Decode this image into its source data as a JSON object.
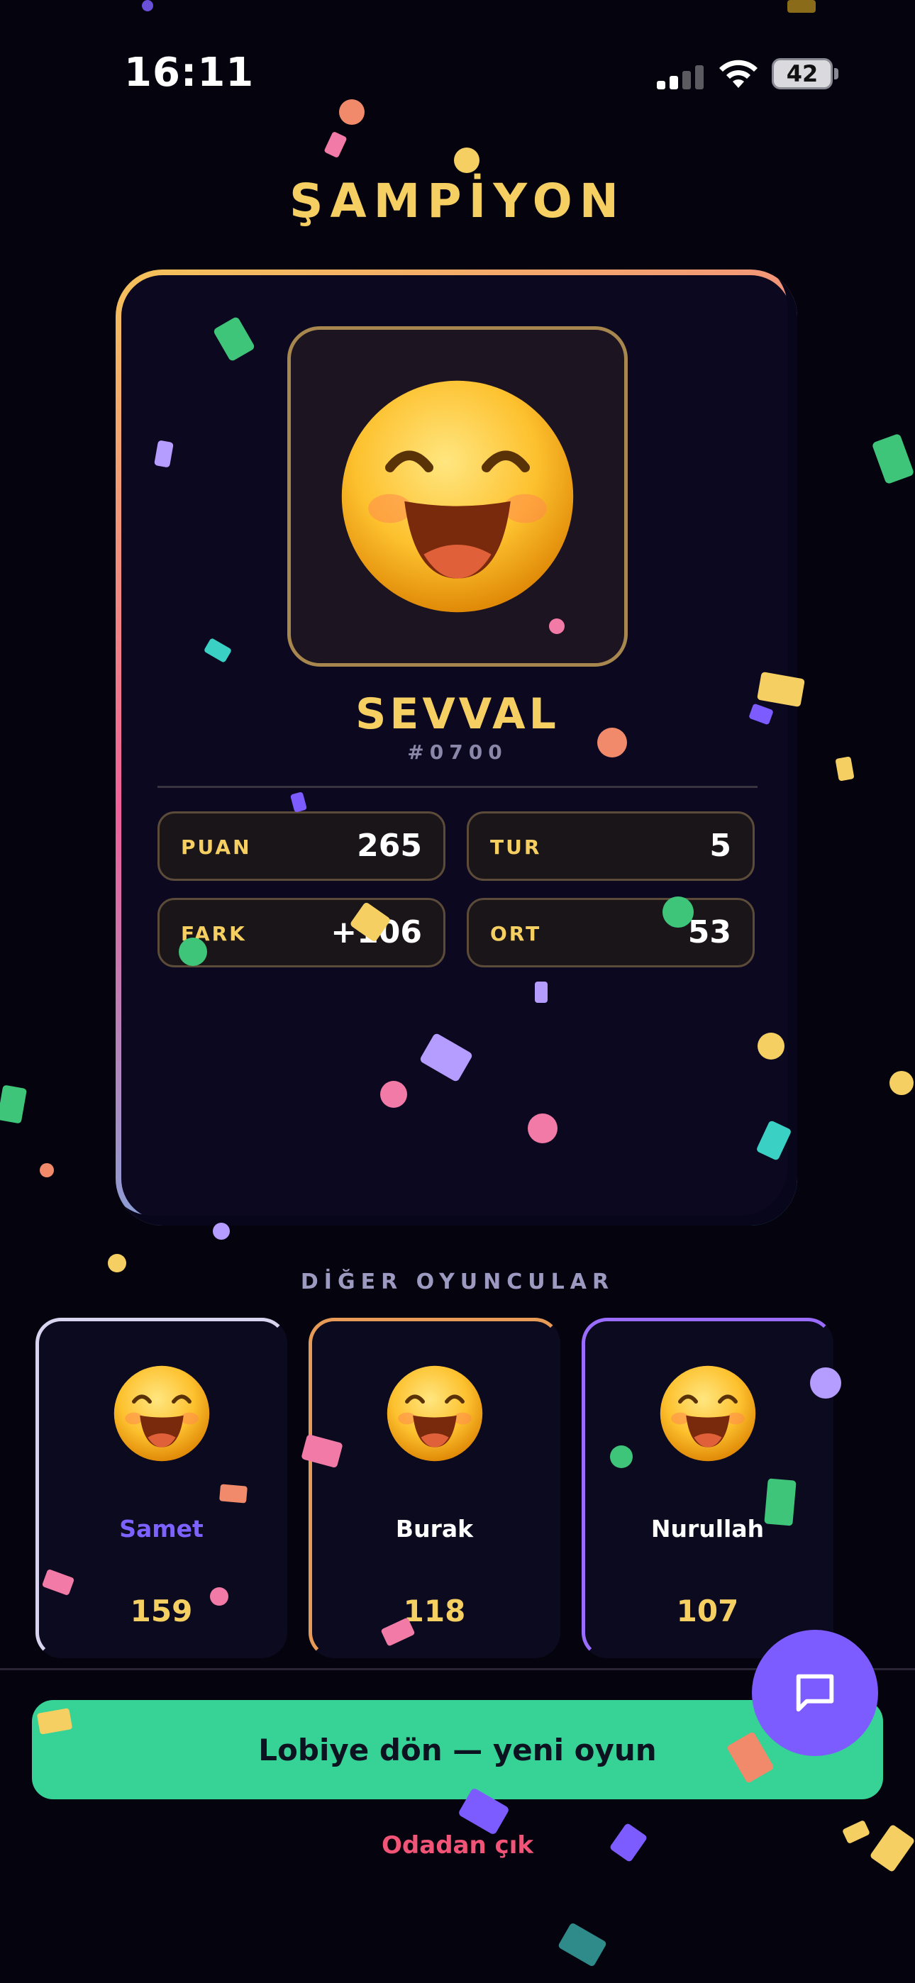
{
  "status_bar": {
    "time": "16:11",
    "battery": "42"
  },
  "title": "ŞAMPİYON",
  "champion": {
    "name": "SEVVAL",
    "tag": "#0700",
    "stats": [
      {
        "label": "PUAN",
        "value": "265"
      },
      {
        "label": "TUR",
        "value": "5"
      },
      {
        "label": "FARK",
        "value": "+106"
      },
      {
        "label": "ORT",
        "value": "53"
      }
    ]
  },
  "others_title": "DİĞER OYUNCULAR",
  "players": [
    {
      "name": "Samet",
      "score": "159",
      "name_color": "#7d62ff",
      "border_color": "#d8d3ef"
    },
    {
      "name": "Burak",
      "score": "118",
      "name_color": "#ffffff",
      "border_color": "#e79b57"
    },
    {
      "name": "Nurullah",
      "score": "107",
      "name_color": "#ffffff",
      "border_color": "#9a6cff"
    }
  ],
  "actions": {
    "lobby_button": "Lobiye dön — yeni oyun",
    "leave_link": "Odadan çık"
  },
  "icons": {
    "chat": "chat-bubble-icon",
    "avatar": "grinning-face-icon"
  },
  "colors": {
    "accent_gold": "#f6cf63",
    "primary_green": "#37d295",
    "fab_purple": "#7d5cff",
    "danger": "#f25478"
  }
}
